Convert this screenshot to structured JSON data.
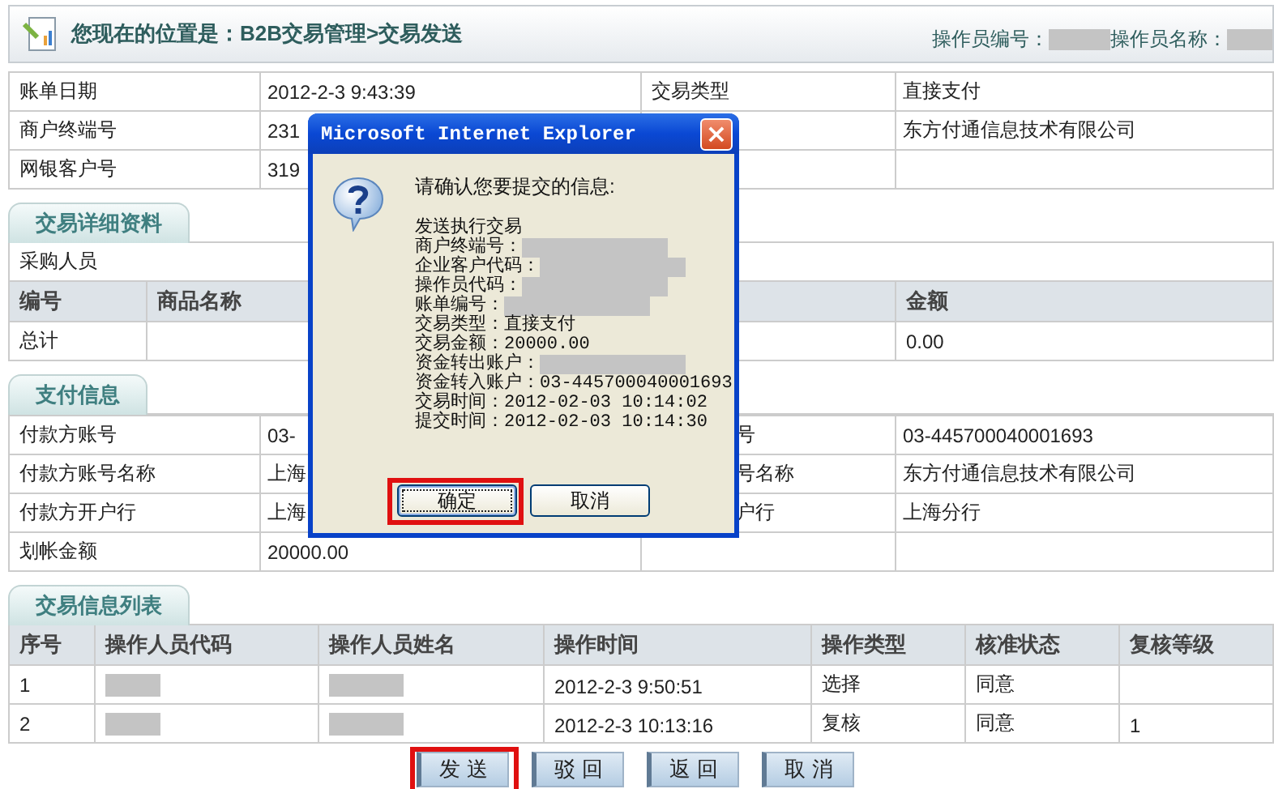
{
  "header": {
    "title": "您现在的位置是：B2B交易管理>交易发送",
    "operator_id_label": "操作员编号：",
    "operator_id_redacted": true,
    "operator_name_label": "操作员名称：",
    "operator_name_redacted": true
  },
  "bill_info": {
    "rows": [
      {
        "label_1": "账单日期",
        "value_1": "2012-2-3 9:43:39",
        "label_2": "交易类型",
        "value_2": "直接支付"
      },
      {
        "label_1": "商户终端号",
        "value_1": "231",
        "value_2": "东方付通信息技术有限公司"
      },
      {
        "label_1": "网银客户号",
        "value_1": "319"
      }
    ]
  },
  "detail": {
    "tab": "交易详细资料",
    "buyer_label": "采购人员",
    "columns": [
      "编号",
      "商品名称",
      "金额"
    ],
    "total": {
      "label": "总计",
      "amount": "0.00"
    }
  },
  "payment": {
    "tab": "支付信息",
    "rows": [
      {
        "label_1": "付款方账号",
        "value_1": "03-",
        "label_2": "号",
        "value_2": "03-445700040001693"
      },
      {
        "label_1": "付款方账号名称",
        "value_1": "上海",
        "label_2": "号名称",
        "value_2": "东方付通信息技术有限公司"
      },
      {
        "label_1": "付款方开户行",
        "value_1": "上海",
        "label_2": "户行",
        "value_2": "上海分行"
      },
      {
        "label_1": "划帐金额",
        "value_1": "20000.00"
      }
    ]
  },
  "operations": {
    "tab": "交易信息列表",
    "columns": [
      "序号",
      "操作人员代码",
      "操作人员姓名",
      "操作时间",
      "操作类型",
      "核准状态",
      "复核等级"
    ],
    "rows": [
      {
        "seq": "1",
        "code_redacted": true,
        "name_redacted": true,
        "time": "2012-2-3 9:50:51",
        "type": "选择",
        "status": "同意"
      },
      {
        "seq": "2",
        "code_redacted": true,
        "name_redacted": true,
        "time": "2012-2-3 10:13:16",
        "type": "复核",
        "status": "同意",
        "review_grade": "1"
      }
    ]
  },
  "buttons": [
    {
      "label": "发 送",
      "highlighted": true
    },
    {
      "label": "驳 回",
      "highlighted": false
    },
    {
      "label": "返 回",
      "highlighted": false
    },
    {
      "label": "取 消",
      "highlighted": false
    }
  ],
  "dialog": {
    "title": "Microsoft Internet Explorer",
    "close": "×",
    "prompt": "请确认您要提交的信息:",
    "lines": [
      {
        "text": "发送执行交易",
        "redacted": false
      },
      {
        "text": "商户终端号：",
        "redacted": true
      },
      {
        "text": "企业客户代码：",
        "redacted": true
      },
      {
        "text": "操作员代码：",
        "redacted": true
      },
      {
        "text": "账单编号：",
        "redacted": true
      },
      {
        "text": "交易类型：直接支付",
        "redacted": false
      },
      {
        "text": "交易金额：20000.00",
        "redacted": false
      },
      {
        "text": "资金转出账户：",
        "redacted": true
      },
      {
        "text": "资金转入账户：03-445700040001693",
        "redacted": false
      },
      {
        "text": "交易时间：2012-02-03 10:14:02",
        "redacted": false
      },
      {
        "text": "提交时间：2012-02-03 10:14:30",
        "redacted": false
      }
    ],
    "buttons": [
      {
        "label": "确定",
        "highlighted": true
      },
      {
        "label": "取消",
        "highlighted": false
      }
    ]
  }
}
